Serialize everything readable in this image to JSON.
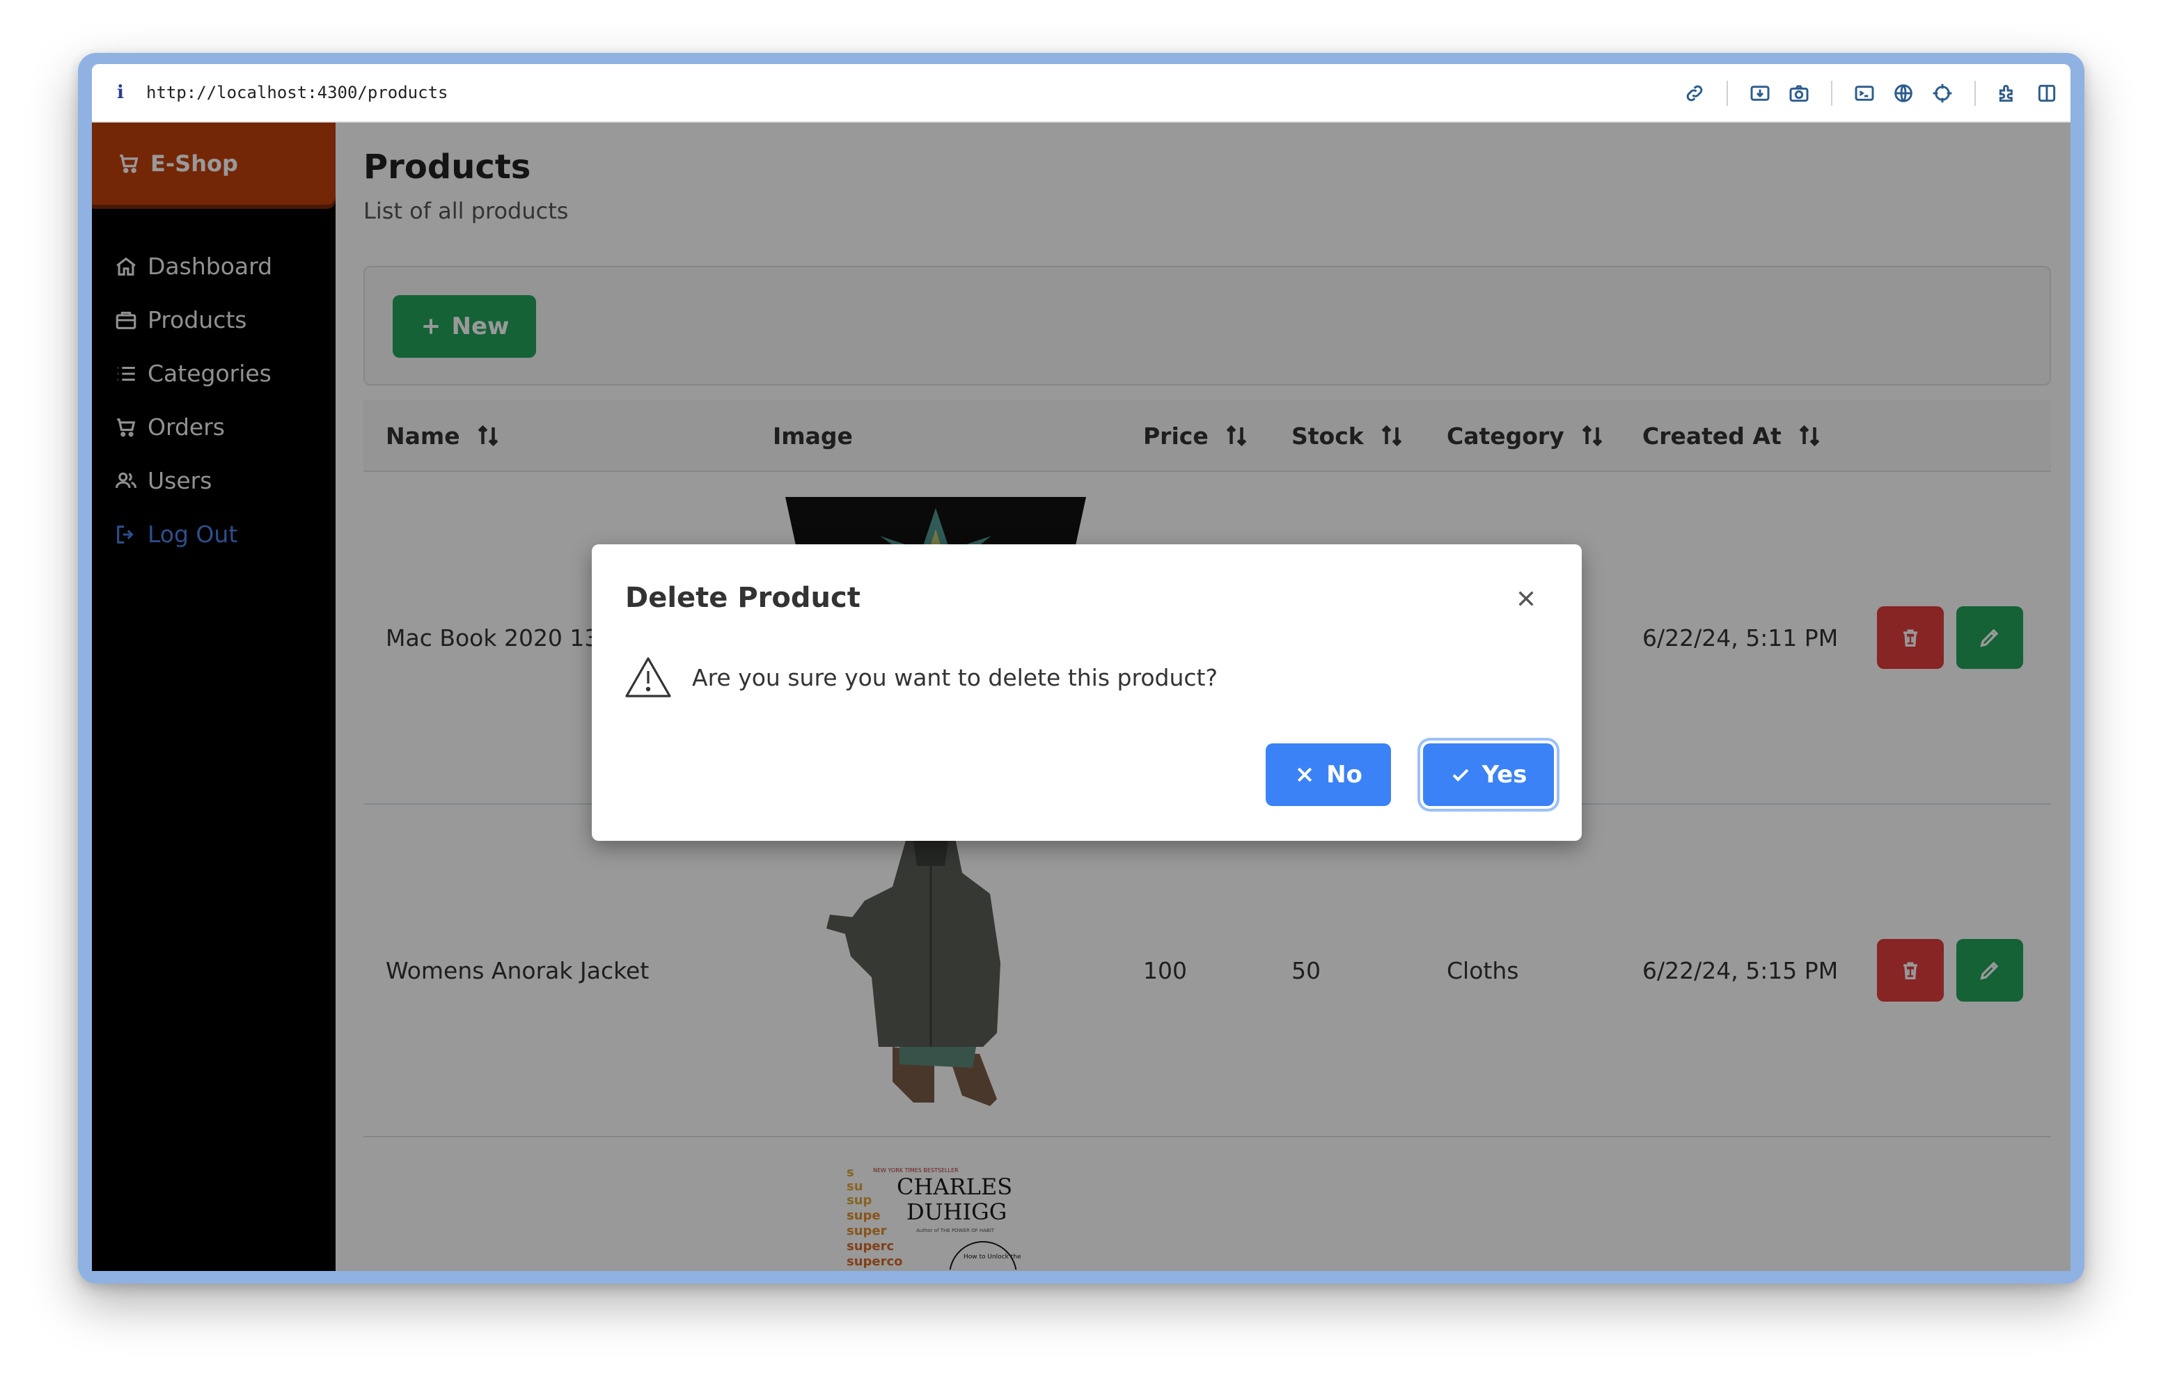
{
  "browser": {
    "info_icon": "i",
    "url": "http://localhost:4300/products",
    "tools": [
      "link-icon",
      "download-icon",
      "camera-icon",
      "terminal-icon",
      "globe-icon",
      "crosshair-icon",
      "extension-icon",
      "split-view-icon"
    ]
  },
  "sidebar": {
    "brand": "E-Shop",
    "items": [
      {
        "label": "Dashboard",
        "icon": "home-icon"
      },
      {
        "label": "Products",
        "icon": "briefcase-icon"
      },
      {
        "label": "Categories",
        "icon": "list-icon"
      },
      {
        "label": "Orders",
        "icon": "cart-icon"
      },
      {
        "label": "Users",
        "icon": "users-icon"
      },
      {
        "label": "Log Out",
        "icon": "logout-icon"
      }
    ]
  },
  "page": {
    "title": "Products",
    "subtitle": "List of all products",
    "new_button": "New"
  },
  "table": {
    "headers": {
      "name": "Name",
      "image": "Image",
      "price": "Price",
      "stock": "Stock",
      "category": "Category",
      "created_at": "Created At"
    },
    "rows": [
      {
        "name": "Mac Book 2020 13\"",
        "price": "",
        "stock": "",
        "category": "",
        "created_at": "6/22/24, 5:11 PM"
      },
      {
        "name": "Womens Anorak Jacket",
        "price": "100",
        "stock": "50",
        "category": "Cloths",
        "created_at": "6/22/24, 5:15 PM"
      },
      {
        "name": "",
        "price": "",
        "stock": "",
        "category": "",
        "created_at": ""
      }
    ],
    "book_cover": {
      "banner": "NEW YORK TIMES BESTSELLER",
      "author_line1": "CHARLES",
      "author_line2": "DUHIGG",
      "byline": "Author of THE POWER OF HABIT",
      "stack": [
        "s",
        "su",
        "sup",
        "supe",
        "super",
        "superc",
        "superco"
      ],
      "badge": "How to Unlock the"
    }
  },
  "dialog": {
    "title": "Delete Product",
    "message": "Are you sure you want to delete this product?",
    "no_label": "No",
    "yes_label": "Yes"
  },
  "colors": {
    "brand": "#c2410c",
    "primary": "#3b82f6",
    "success": "#22a35a",
    "danger": "#e23c3c",
    "sidebar_bg": "#000000"
  }
}
